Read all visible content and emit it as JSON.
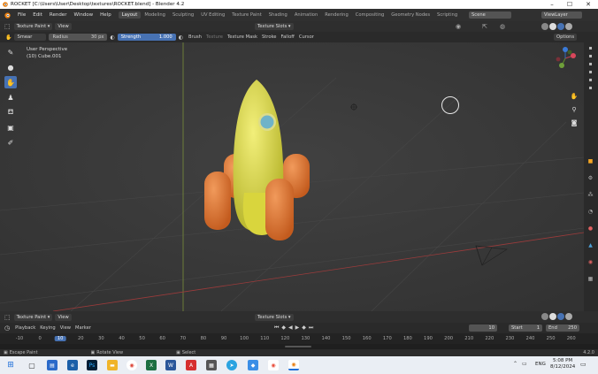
{
  "window": {
    "title": "ROCKET [C:\\Users\\User\\Desktop\\textures\\ROCKET.blend] - Blender 4.2",
    "min_icon": "minimize-icon",
    "max_icon": "maximize-icon",
    "close_icon": "close-icon"
  },
  "menubar": {
    "items": [
      "File",
      "Edit",
      "Render",
      "Window",
      "Help"
    ],
    "workspaces": [
      "Layout",
      "Modeling",
      "Sculpting",
      "UV Editing",
      "Texture Paint",
      "Shading",
      "Animation",
      "Rendering",
      "Compositing",
      "Geometry Nodes",
      "Scripting"
    ],
    "active_workspace": "Layout",
    "scene": "Scene",
    "view_layer": "ViewLayer"
  },
  "viewport_header": {
    "mode": "Texture Paint",
    "view": "View",
    "texture_slots": "Texture Slots"
  },
  "tool_settings": {
    "brush_name": "Smear",
    "radius_label": "Radius",
    "radius_value": "30 px",
    "strength_label": "Strength",
    "strength_value": "1.000",
    "brush": "Brush",
    "texture": "Texture",
    "texture_mask": "Texture Mask",
    "stroke": "Stroke",
    "falloff": "Falloff",
    "cursor": "Cursor",
    "options": "Options"
  },
  "viewport": {
    "perspective": "User Perspective",
    "object": "(10) Cube.001"
  },
  "bottom_header": {
    "mode": "Texture Paint",
    "view": "View",
    "texture_slots": "Texture Slots"
  },
  "timeline": {
    "playback": "Playback",
    "keying": "Keying",
    "view": "View",
    "marker": "Marker",
    "current_frame": "10",
    "start_label": "Start",
    "start_value": "1",
    "end_label": "End",
    "end_value": "250",
    "ruler": [
      "-10",
      "0",
      "10",
      "20",
      "30",
      "40",
      "50",
      "60",
      "70",
      "80",
      "90",
      "100",
      "110",
      "120",
      "130",
      "140",
      "150",
      "160",
      "170",
      "180",
      "190",
      "200",
      "210",
      "220",
      "230",
      "240",
      "250",
      "260"
    ]
  },
  "statusbar": {
    "escape": "Escape Paint",
    "rotate": "Rotate View",
    "select": "Select",
    "version": "4.2.0"
  },
  "taskbar": {
    "lang": "ENG",
    "time": "5:08 PM",
    "date": "8/12/2024"
  },
  "colors": {
    "accent": "#4772b3",
    "rocket_body": "#e3e04a",
    "rocket_legs": "#e07a36",
    "window_porthole": "#6fb3c8"
  }
}
